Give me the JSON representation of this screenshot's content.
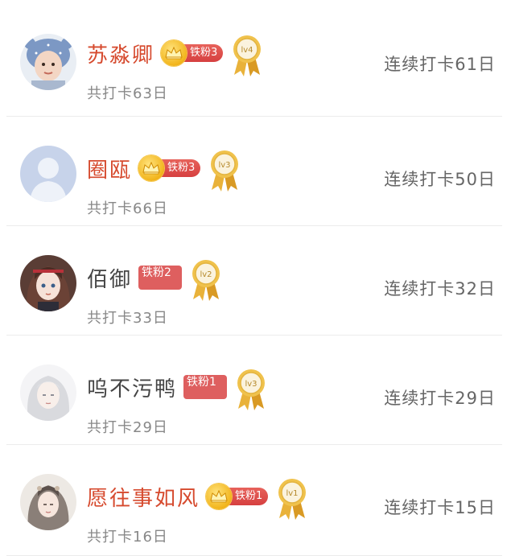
{
  "colors": {
    "vip_name": "#d64a2e",
    "normal_name": "#444444",
    "fan_badge": "#de5f5f",
    "crown_gold": "#f2b51c",
    "secondary_text": "#888888",
    "divider": "#ececec"
  },
  "rows": [
    {
      "name": "苏淼卿",
      "name_style": "vip",
      "fan_badge": {
        "label": "铁粉3",
        "crown": true
      },
      "level_medal": "lv4",
      "total": "共打卡63日",
      "streak": "连续打卡61日",
      "avatar_icon": "child-with-bear-hat-avatar"
    },
    {
      "name": "圈瓯",
      "name_style": "vip",
      "fan_badge": {
        "label": "铁粉3",
        "crown": true
      },
      "level_medal": "lv3",
      "total": "共打卡66日",
      "streak": "连续打卡50日",
      "avatar_icon": "default-user-avatar"
    },
    {
      "name": "佰御",
      "name_style": "normal",
      "fan_badge": {
        "label": "铁粉2",
        "crown": false
      },
      "level_medal": "lv2",
      "total": "共打卡33日",
      "streak": "连续打卡32日",
      "avatar_icon": "anime-girl-avatar"
    },
    {
      "name": "呜不污鸭",
      "name_style": "normal",
      "fan_badge": {
        "label": "铁粉1",
        "crown": false
      },
      "level_medal": "lv3",
      "total": "共打卡29日",
      "streak": "连续打卡29日",
      "avatar_icon": "white-hair-character-avatar"
    },
    {
      "name": "愿往事如风",
      "name_style": "vip",
      "fan_badge": {
        "label": "铁粉1",
        "crown": true
      },
      "level_medal": "lv1",
      "total": "共打卡16日",
      "streak": "连续打卡15日",
      "avatar_icon": "ancient-costume-avatar"
    }
  ]
}
